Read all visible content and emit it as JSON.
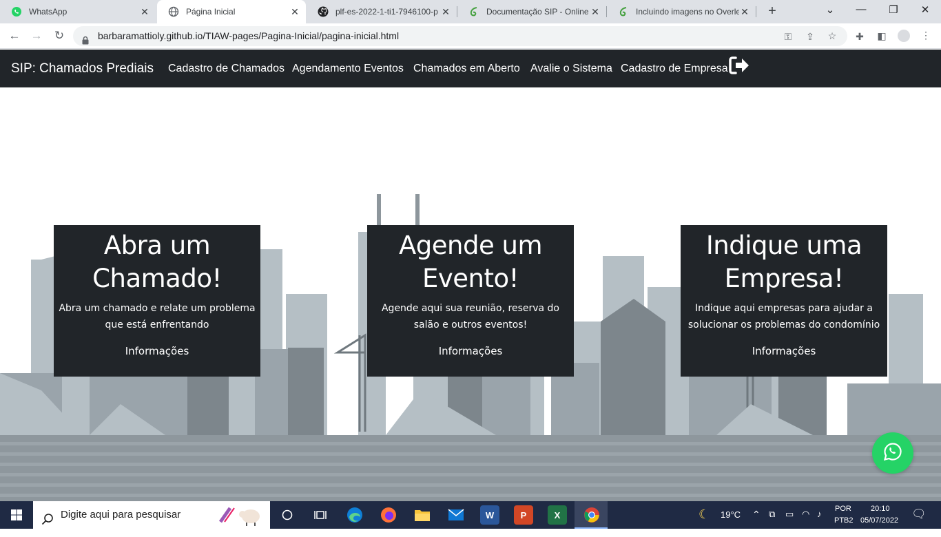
{
  "browser": {
    "tabs": [
      {
        "title": "WhatsApp",
        "icon": "whatsapp-icon"
      },
      {
        "title": "Página Inicial",
        "icon": "globe-icon"
      },
      {
        "title": "plf-es-2022-1-ti1-7946100-p",
        "icon": "github-icon"
      },
      {
        "title": "Documentação SIP - Online L",
        "icon": "overleaf-icon"
      },
      {
        "title": "Incluindo imagens no Overle",
        "icon": "overleaf-icon"
      }
    ],
    "url": "barbaramattioly.github.io/TIAW-pages/Pagina-Inicial/pagina-inicial.html"
  },
  "site": {
    "brand": "SIP: Chamados Prediais",
    "nav": [
      "Cadastro de Chamados",
      "Agendamento Eventos",
      "Chamados em Aberto",
      "Avalie o Sistema",
      "Cadastro de Empresa"
    ],
    "cards": [
      {
        "title": "Abra um Chamado!",
        "text": "Abra um chamado e relate um problema que está enfrentando",
        "link": "Informações"
      },
      {
        "title": "Agende um Evento!",
        "text": "Agende aqui sua reunião, reserva do salão e outros eventos!",
        "link": "Informações"
      },
      {
        "title": "Indique uma Empresa!",
        "text": "Indique aqui empresas para ajudar a solucionar os problemas do condomínio",
        "link": "Informações"
      }
    ]
  },
  "taskbar": {
    "search_placeholder": "Digite aqui para pesquisar",
    "weather": "19°C",
    "lang_top": "POR",
    "lang_bottom": "PTB2",
    "time": "20:10",
    "date": "05/07/2022",
    "apps": [
      {
        "label": "W",
        "color": "#2b579a"
      },
      {
        "label": "P",
        "color": "#d24726"
      },
      {
        "label": "X",
        "color": "#217346"
      }
    ]
  },
  "colors": {
    "navbar": "#212529",
    "whatsapp": "#25d366",
    "taskbar": "#1f2a44"
  }
}
